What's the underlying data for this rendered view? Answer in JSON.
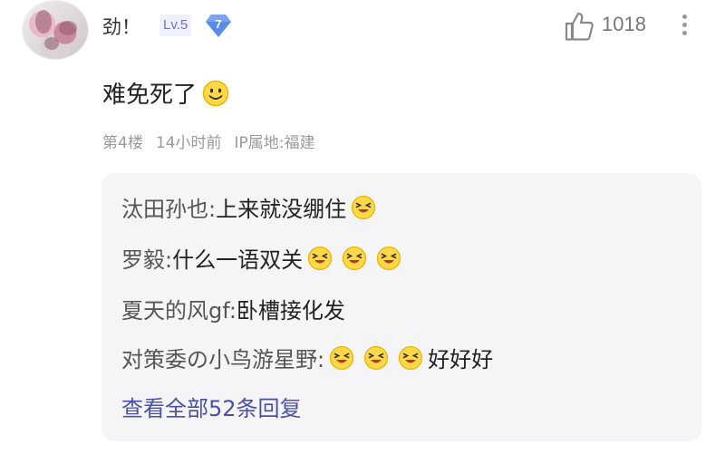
{
  "user": {
    "name": "劲！",
    "level": "Lv.5",
    "badge_number": "7"
  },
  "likes": {
    "count": "1018"
  },
  "comment": {
    "text": "难免死了",
    "emoji": "smile-emoji"
  },
  "meta": {
    "floor": "第4楼",
    "time": "14小时前",
    "ip": "IP属地:福建"
  },
  "replies": [
    {
      "author": "汰田孙也:",
      "text": " 上来就没绷住",
      "emoji_count": 1,
      "text_after": ""
    },
    {
      "author": "罗毅:",
      "text": " 什么一语双关",
      "emoji_count": 3,
      "text_after": ""
    },
    {
      "author": "夏天的风gf:",
      "text": " 卧槽接化发",
      "emoji_count": 0,
      "text_after": ""
    },
    {
      "author": "对策委の小鸟游星野:",
      "text": " ",
      "emoji_count": 3,
      "text_after": "好好好"
    }
  ],
  "view_all": "查看全部52条回复",
  "colors": {
    "link": "#4a4fa8",
    "level_bg": "#eef0fb",
    "badge": "#5a8be8",
    "reply_bg": "#f5f5f7"
  }
}
